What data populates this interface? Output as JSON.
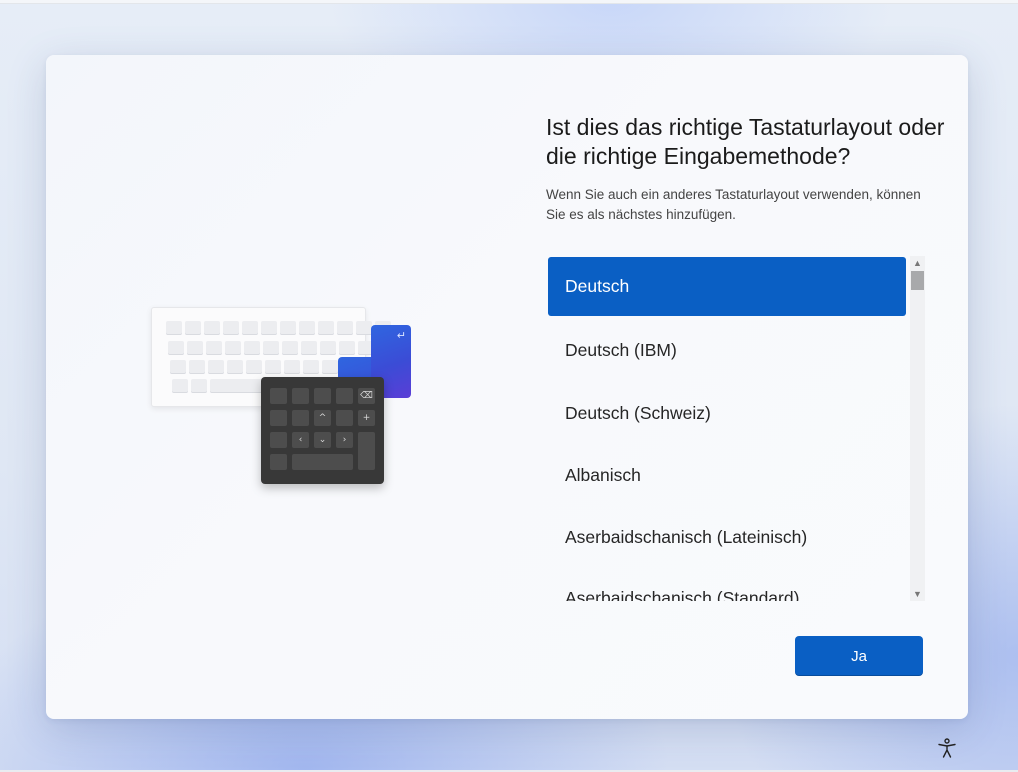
{
  "page": {
    "title": "Ist dies das richtige Tastaturlayout oder die richtige Eingabemethode?",
    "subtitle": "Wenn Sie auch ein anderes Tastaturlayout verwenden, können Sie es als nächstes hinzufügen."
  },
  "layouts": {
    "selected_index": 0,
    "items": [
      {
        "label": "Deutsch"
      },
      {
        "label": "Deutsch (IBM)"
      },
      {
        "label": "Deutsch (Schweiz)"
      },
      {
        "label": "Albanisch"
      },
      {
        "label": "Aserbaidschanisch (Lateinisch)"
      },
      {
        "label": "Aserbaidschanisch (Standard)"
      }
    ]
  },
  "actions": {
    "confirm_label": "Ja"
  },
  "icons": {
    "accessibility": "accessibility-icon",
    "scroll_up": "chevron-up-icon",
    "scroll_down": "chevron-down-icon"
  },
  "colors": {
    "accent": "#0a5fc4",
    "selected_text": "#ffffff"
  }
}
